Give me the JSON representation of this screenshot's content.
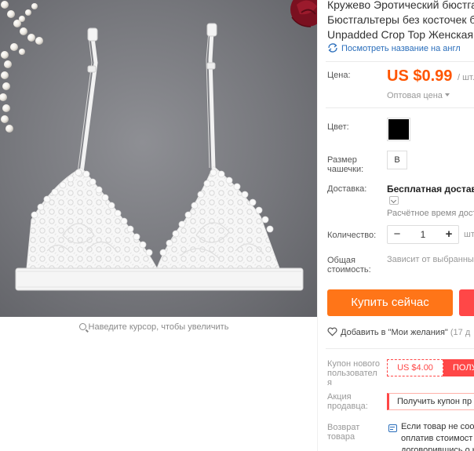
{
  "gallery": {
    "image_alt": "White lace triangle bralette on grey background with pearls and a red rose",
    "zoom_hint": "Наведите курсор, чтобы увеличить"
  },
  "product": {
    "title_lines": [
      "Кружево Эротический бюстга",
      "Бюстгальтеры без косточек б",
      "Unpadded Crop Top Женская Н"
    ],
    "translate_link": "Посмотреть название на англ"
  },
  "price": {
    "label": "Цена:",
    "value": "US $0.99",
    "unit": "/ шт.",
    "wholesale": "Оптовая цена"
  },
  "color": {
    "label": "Цвет:",
    "swatch_color": "#000000"
  },
  "size": {
    "label_line1": "Размер",
    "label_line2": "чашечки:",
    "option": "B"
  },
  "shipping": {
    "label": "Доставка:",
    "value": "Бесплатная доставка",
    "estimate": "Расчётное время дост"
  },
  "quantity": {
    "label": "Количество:",
    "minus": "−",
    "value": "1",
    "plus": "+",
    "unit": "шт"
  },
  "total": {
    "label_line1": "Общая",
    "label_line2": "стоимость:",
    "note": "Зависит от выбранны"
  },
  "actions": {
    "buy_now": "Купить сейчас",
    "wishlist": "Добавить в \"Мои желания\"",
    "wishlist_count": "(17 д"
  },
  "coupon": {
    "label_line1": "Купон нового",
    "label_line2": "пользовател",
    "label_line3": "я",
    "value": "US $4.00",
    "get": "ПОЛУ"
  },
  "promo": {
    "label_line1": "Акция",
    "label_line2": "продавца:",
    "text": "Получить купон пр"
  },
  "returns": {
    "label_line1": "Возврат",
    "label_line2": "товара",
    "text_line1": "Если товар не соот",
    "text_line2": "оплатив стоимост",
    "text_line3": "договорившись о ко"
  },
  "colors": {
    "accent_orange": "#ff7518",
    "price_orange": "#ff5500",
    "coupon_red": "#ff4747",
    "link_blue": "#2a6ebb"
  }
}
